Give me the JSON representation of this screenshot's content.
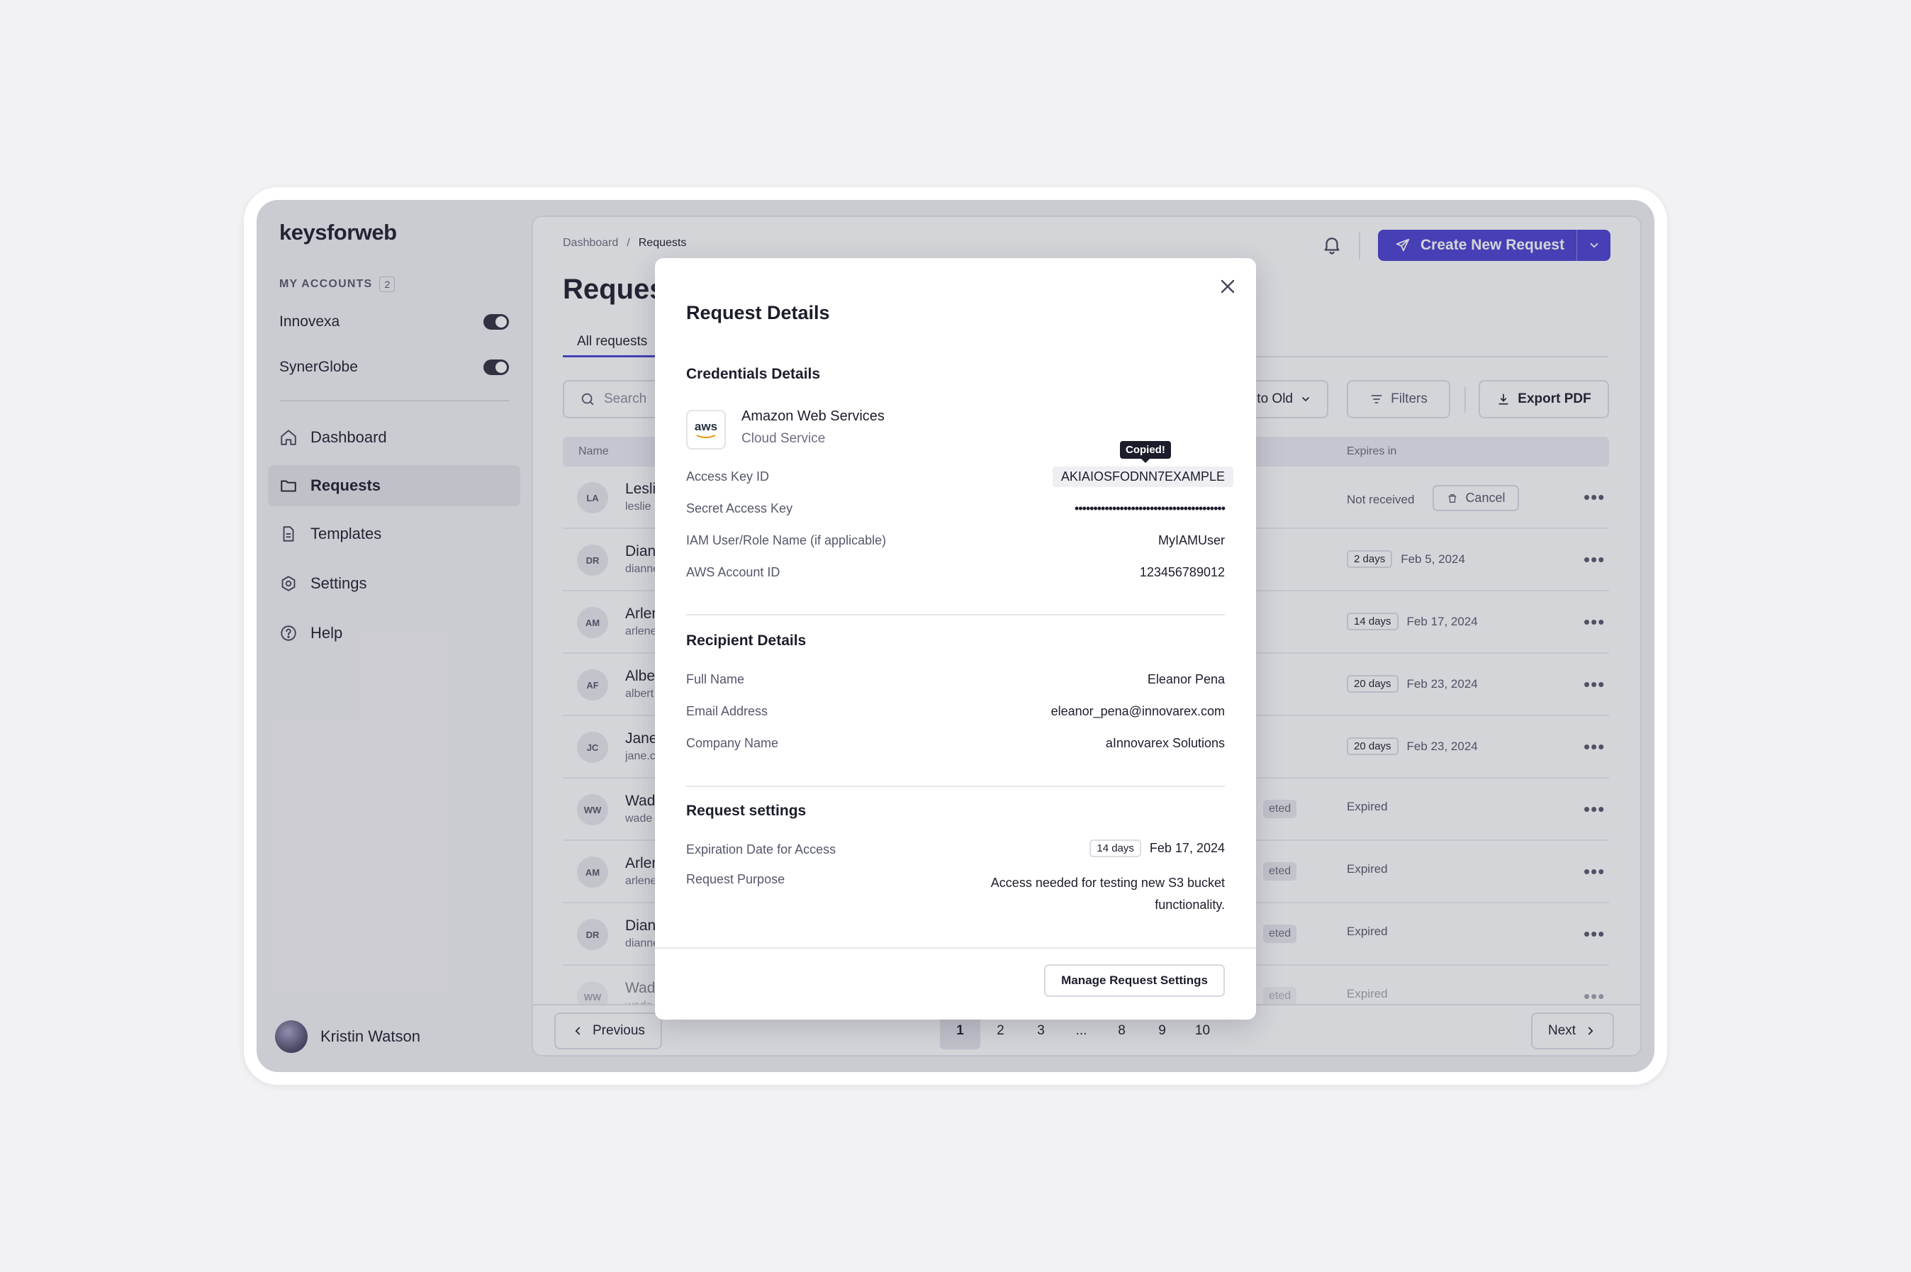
{
  "sidebar": {
    "logo": "keysforweb",
    "accounts_header": "MY ACCOUNTS",
    "accounts_count": "2",
    "accounts": [
      {
        "name": "Innovexa",
        "enabled": true
      },
      {
        "name": "SynerGlobe",
        "enabled": true
      }
    ],
    "nav": [
      {
        "label": "Dashboard",
        "icon": "home-icon"
      },
      {
        "label": "Requests",
        "icon": "folder-icon",
        "active": true
      },
      {
        "label": "Templates",
        "icon": "document-icon"
      },
      {
        "label": "Settings",
        "icon": "gear-icon"
      },
      {
        "label": "Help",
        "icon": "help-circle-icon"
      }
    ],
    "user_name": "Kristin Watson"
  },
  "header": {
    "breadcrumb": [
      "Dashboard",
      "Requests"
    ],
    "breadcrumb_sep": "/",
    "create_button": "Create New Request"
  },
  "main": {
    "title_partial": "Reques",
    "tab_all": "All requests",
    "search_placeholder": "Search",
    "sort_label": "y to Old",
    "filters_label": "Filters",
    "export_label": "Export PDF",
    "columns": {
      "name": "Name",
      "expires": "Expires in"
    },
    "rows": [
      {
        "initials": "LA",
        "name": "Leslie",
        "email": "leslie",
        "status": "",
        "expires_text": "Not received",
        "badge": "",
        "date": "",
        "cancel": "Cancel"
      },
      {
        "initials": "DR",
        "name": "Diane",
        "email": "dianne",
        "status": "",
        "expires_text": "",
        "badge": "2 days",
        "date": "Feb 5, 2024",
        "cancel": ""
      },
      {
        "initials": "AM",
        "name": "Arlene",
        "email": "arlene",
        "status": "",
        "expires_text": "",
        "badge": "14 days",
        "date": "Feb 17, 2024",
        "cancel": ""
      },
      {
        "initials": "AF",
        "name": "Albert",
        "email": "albert",
        "status": "",
        "expires_text": "",
        "badge": "20 days",
        "date": "Feb 23, 2024",
        "cancel": ""
      },
      {
        "initials": "JC",
        "name": "Jane",
        "email": "jane.c",
        "status": "",
        "expires_text": "",
        "badge": "20 days",
        "date": "Feb 23, 2024",
        "cancel": ""
      },
      {
        "initials": "WW",
        "name": "Wade",
        "email": "wade",
        "status": "eted",
        "expires_text": "Expired",
        "badge": "",
        "date": "",
        "cancel": ""
      },
      {
        "initials": "AM",
        "name": "Arlene",
        "email": "arlene",
        "status": "eted",
        "expires_text": "Expired",
        "badge": "",
        "date": "",
        "cancel": ""
      },
      {
        "initials": "DR",
        "name": "Diane",
        "email": "dianne",
        "status": "eted",
        "expires_text": "Expired",
        "badge": "",
        "date": "",
        "cancel": ""
      },
      {
        "initials": "WW",
        "name": "Wade",
        "email": "wade",
        "status": "eted",
        "expires_text": "Expired",
        "badge": "",
        "date": "",
        "cancel": ""
      }
    ]
  },
  "pagination": {
    "previous": "Previous",
    "next": "Next",
    "pages": [
      "1",
      "2",
      "3",
      "...",
      "8",
      "9",
      "10"
    ],
    "current": "1"
  },
  "modal": {
    "title": "Request Details",
    "credentials": {
      "heading": "Credentials Details",
      "logo_text": "aws",
      "service_name": "Amazon Web Services",
      "service_type": "Cloud Service",
      "tooltip": "Copied!",
      "fields": [
        {
          "label": "Access Key ID",
          "value": "AKIAIOSFODNN7EXAMPLE"
        },
        {
          "label": "Secret Access Key",
          "value": "••••••••••••••••••••••••••••••••••••••••"
        },
        {
          "label": "IAM User/Role Name (if applicable)",
          "value": "MyIAMUser"
        },
        {
          "label": "AWS Account ID",
          "value": "123456789012"
        }
      ]
    },
    "recipient": {
      "heading": "Recipient Details",
      "fields": [
        {
          "label": "Full Name",
          "value": "Eleanor Pena"
        },
        {
          "label": "Email Address",
          "value": "eleanor_pena@innovarex.com"
        },
        {
          "label": "Company Name",
          "value": "aInnovarex Solutions"
        }
      ]
    },
    "settings": {
      "heading": "Request settings",
      "expiration_label": "Expiration Date for Access",
      "expiration_badge": "14 days",
      "expiration_date": "Feb 17, 2024",
      "purpose_label": "Request Purpose",
      "purpose_value": "Access needed for testing new S3 bucket functionality."
    },
    "manage_button": "Manage Request Settings"
  },
  "colors": {
    "accent": "#4b3fd1",
    "text": "#1c1d2b",
    "muted": "#6b6d80"
  }
}
